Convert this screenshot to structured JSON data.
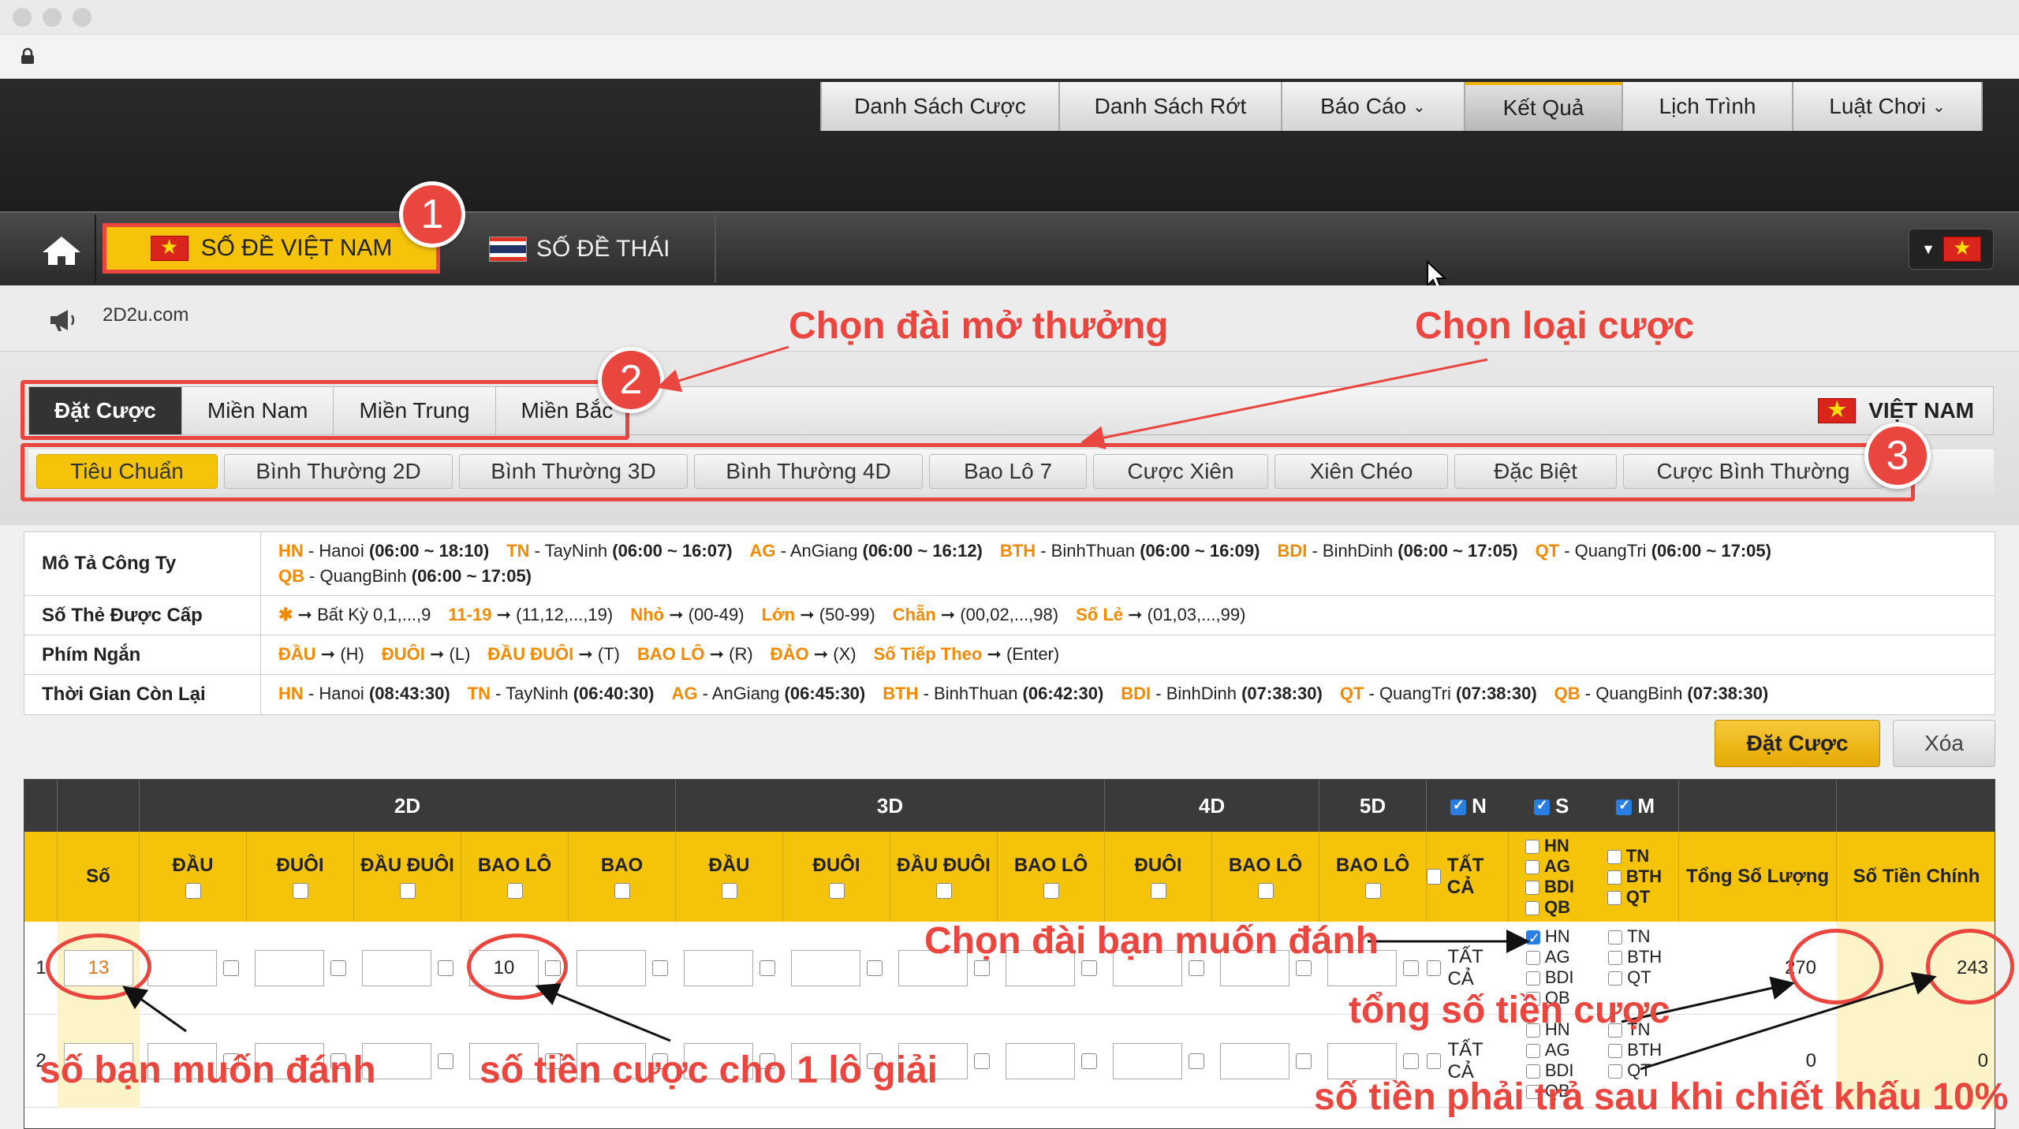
{
  "nav": {
    "items": [
      {
        "label": "Danh Sách Cược",
        "caret": false,
        "active": false
      },
      {
        "label": "Danh Sách Rớt",
        "caret": false,
        "active": false
      },
      {
        "label": "Báo Cáo",
        "caret": true,
        "active": false
      },
      {
        "label": "Kết Quả",
        "caret": false,
        "active": true
      },
      {
        "label": "Lịch Trình",
        "caret": false,
        "active": false
      },
      {
        "label": "Luật Chơi",
        "caret": true,
        "active": false
      }
    ]
  },
  "products": {
    "vn_label": "SỐ ĐỀ VIỆT NAM",
    "th_label": "SỐ ĐỀ THÁI"
  },
  "marquee": {
    "site": "2D2u.com"
  },
  "tabs_region": {
    "items": [
      "Đặt Cược",
      "Miền Nam",
      "Miền Trung",
      "Miền Bắc"
    ],
    "country": "VIỆT NAM"
  },
  "tabs_bet": {
    "items": [
      "Tiêu Chuẩn",
      "Bình Thường 2D",
      "Bình Thường 3D",
      "Bình Thường 4D",
      "Bao Lô 7",
      "Cược Xiên",
      "Xiên Chéo",
      "Đặc Biệt",
      "Cược Bình Thường"
    ]
  },
  "annotations": {
    "badge1": "1",
    "badge2": "2",
    "badge3": "3",
    "choose_station": "Chọn đài mở thưởng",
    "choose_bet_type": "Chọn loại cược",
    "choose_station_to_bet": "Chọn đài bạn muốn đánh",
    "total_bet": "tổng số tiền cược",
    "number_to_bet": "số bạn muốn đánh",
    "bet_per_lot": "số tiền cược cho 1 lô giải",
    "after_discount": "số tiền phải trả sau khi chiết khấu 10%"
  },
  "info": {
    "company_label": "Mô Tả Công Ty",
    "company_line1": [
      {
        "k": "HN",
        "v": " - Hanoi ",
        "t": "(06:00 ~ 18:10)"
      },
      {
        "k": "TN",
        "v": " - TayNinh ",
        "t": "(06:00 ~ 16:07)"
      },
      {
        "k": "AG",
        "v": " - AnGiang ",
        "t": "(06:00 ~ 16:12)"
      },
      {
        "k": "BTH",
        "v": " - BinhThuan ",
        "t": "(06:00 ~ 16:09)"
      },
      {
        "k": "BDI",
        "v": " - BinhDinh ",
        "t": "(06:00 ~ 17:05)"
      },
      {
        "k": "QT",
        "v": " - QuangTri ",
        "t": "(06:00 ~ 17:05)"
      }
    ],
    "company_line2": [
      {
        "k": "QB",
        "v": " - QuangBinh ",
        "t": "(06:00 ~ 17:05)"
      }
    ],
    "cards_label": "Số Thẻ Được Cấp",
    "cards": [
      {
        "k": "✱",
        "v": " ➞ Bất Kỳ 0,1,...,9"
      },
      {
        "k": "11-19",
        "v": " ➞ (11,12,...,19)"
      },
      {
        "k": "Nhỏ",
        "v": " ➞ (00-49)"
      },
      {
        "k": "Lớn",
        "v": " ➞ (50-99)"
      },
      {
        "k": "Chẵn",
        "v": " ➞ (00,02,...,98)"
      },
      {
        "k": "Số Lẻ",
        "v": " ➞ (01,03,...,99)"
      }
    ],
    "shortcut_label": "Phím Ngắn",
    "shortcuts": [
      {
        "k": "ĐẦU",
        "v": " ➞ (H)"
      },
      {
        "k": "ĐUÔI",
        "v": " ➞ (L)"
      },
      {
        "k": "ĐẦU ĐUÔI",
        "v": " ➞ (T)"
      },
      {
        "k": "BAO LÔ",
        "v": " ➞ (R)"
      },
      {
        "k": "ĐẢO",
        "v": " ➞ (X)"
      },
      {
        "k": "Số Tiếp Theo",
        "v": " ➞ (Enter)"
      }
    ],
    "remaining_label": "Thời Gian Còn Lại",
    "remaining": [
      {
        "k": "HN",
        "v": " - Hanoi ",
        "t": "(08:43:30)"
      },
      {
        "k": "TN",
        "v": " - TayNinh ",
        "t": "(06:40:30)"
      },
      {
        "k": "AG",
        "v": " - AnGiang ",
        "t": "(06:45:30)"
      },
      {
        "k": "BTH",
        "v": " - BinhThuan ",
        "t": "(06:42:30)"
      },
      {
        "k": "BDI",
        "v": " - BinhDinh ",
        "t": "(07:38:30)"
      },
      {
        "k": "QT",
        "v": " - QuangTri ",
        "t": "(07:38:30)"
      },
      {
        "k": "QB",
        "v": " - QuangBinh ",
        "t": "(07:38:30)"
      }
    ]
  },
  "actions": {
    "bet": "Đặt Cược",
    "clear": "Xóa"
  },
  "grid": {
    "groups": {
      "g2d": "2D",
      "g3d": "3D",
      "g4d": "4D",
      "g5d": "5D",
      "n": "N",
      "s": "S",
      "m": "M"
    },
    "cols": {
      "so": "Số",
      "c2d": [
        "ĐẦU",
        "ĐUÔI",
        "ĐẦU ĐUÔI",
        "BAO LÔ",
        "BAO"
      ],
      "c3d": [
        "ĐẦU",
        "ĐUÔI",
        "ĐẦU ĐUÔI",
        "BAO LÔ"
      ],
      "c4d": [
        "ĐUÔI",
        "BAO LÔ"
      ],
      "c5d": [
        "BAO LÔ"
      ],
      "all": "TẤT CẢ",
      "st_left": [
        "HN",
        "AG",
        "BDI",
        "QB"
      ],
      "st_right": [
        "TN",
        "BTH",
        "QT"
      ],
      "total_qty": "Tổng Số Lượng",
      "net": "Số Tiền Chính"
    },
    "rows": [
      {
        "idx": "1",
        "so": "13",
        "bao_lo": "10",
        "all": "TẤT CẢ",
        "total": "270",
        "net": "243"
      },
      {
        "idx": "2",
        "so": "",
        "bao_lo": "",
        "all": "TẤT CẢ",
        "total": "0",
        "net": "0"
      }
    ]
  }
}
